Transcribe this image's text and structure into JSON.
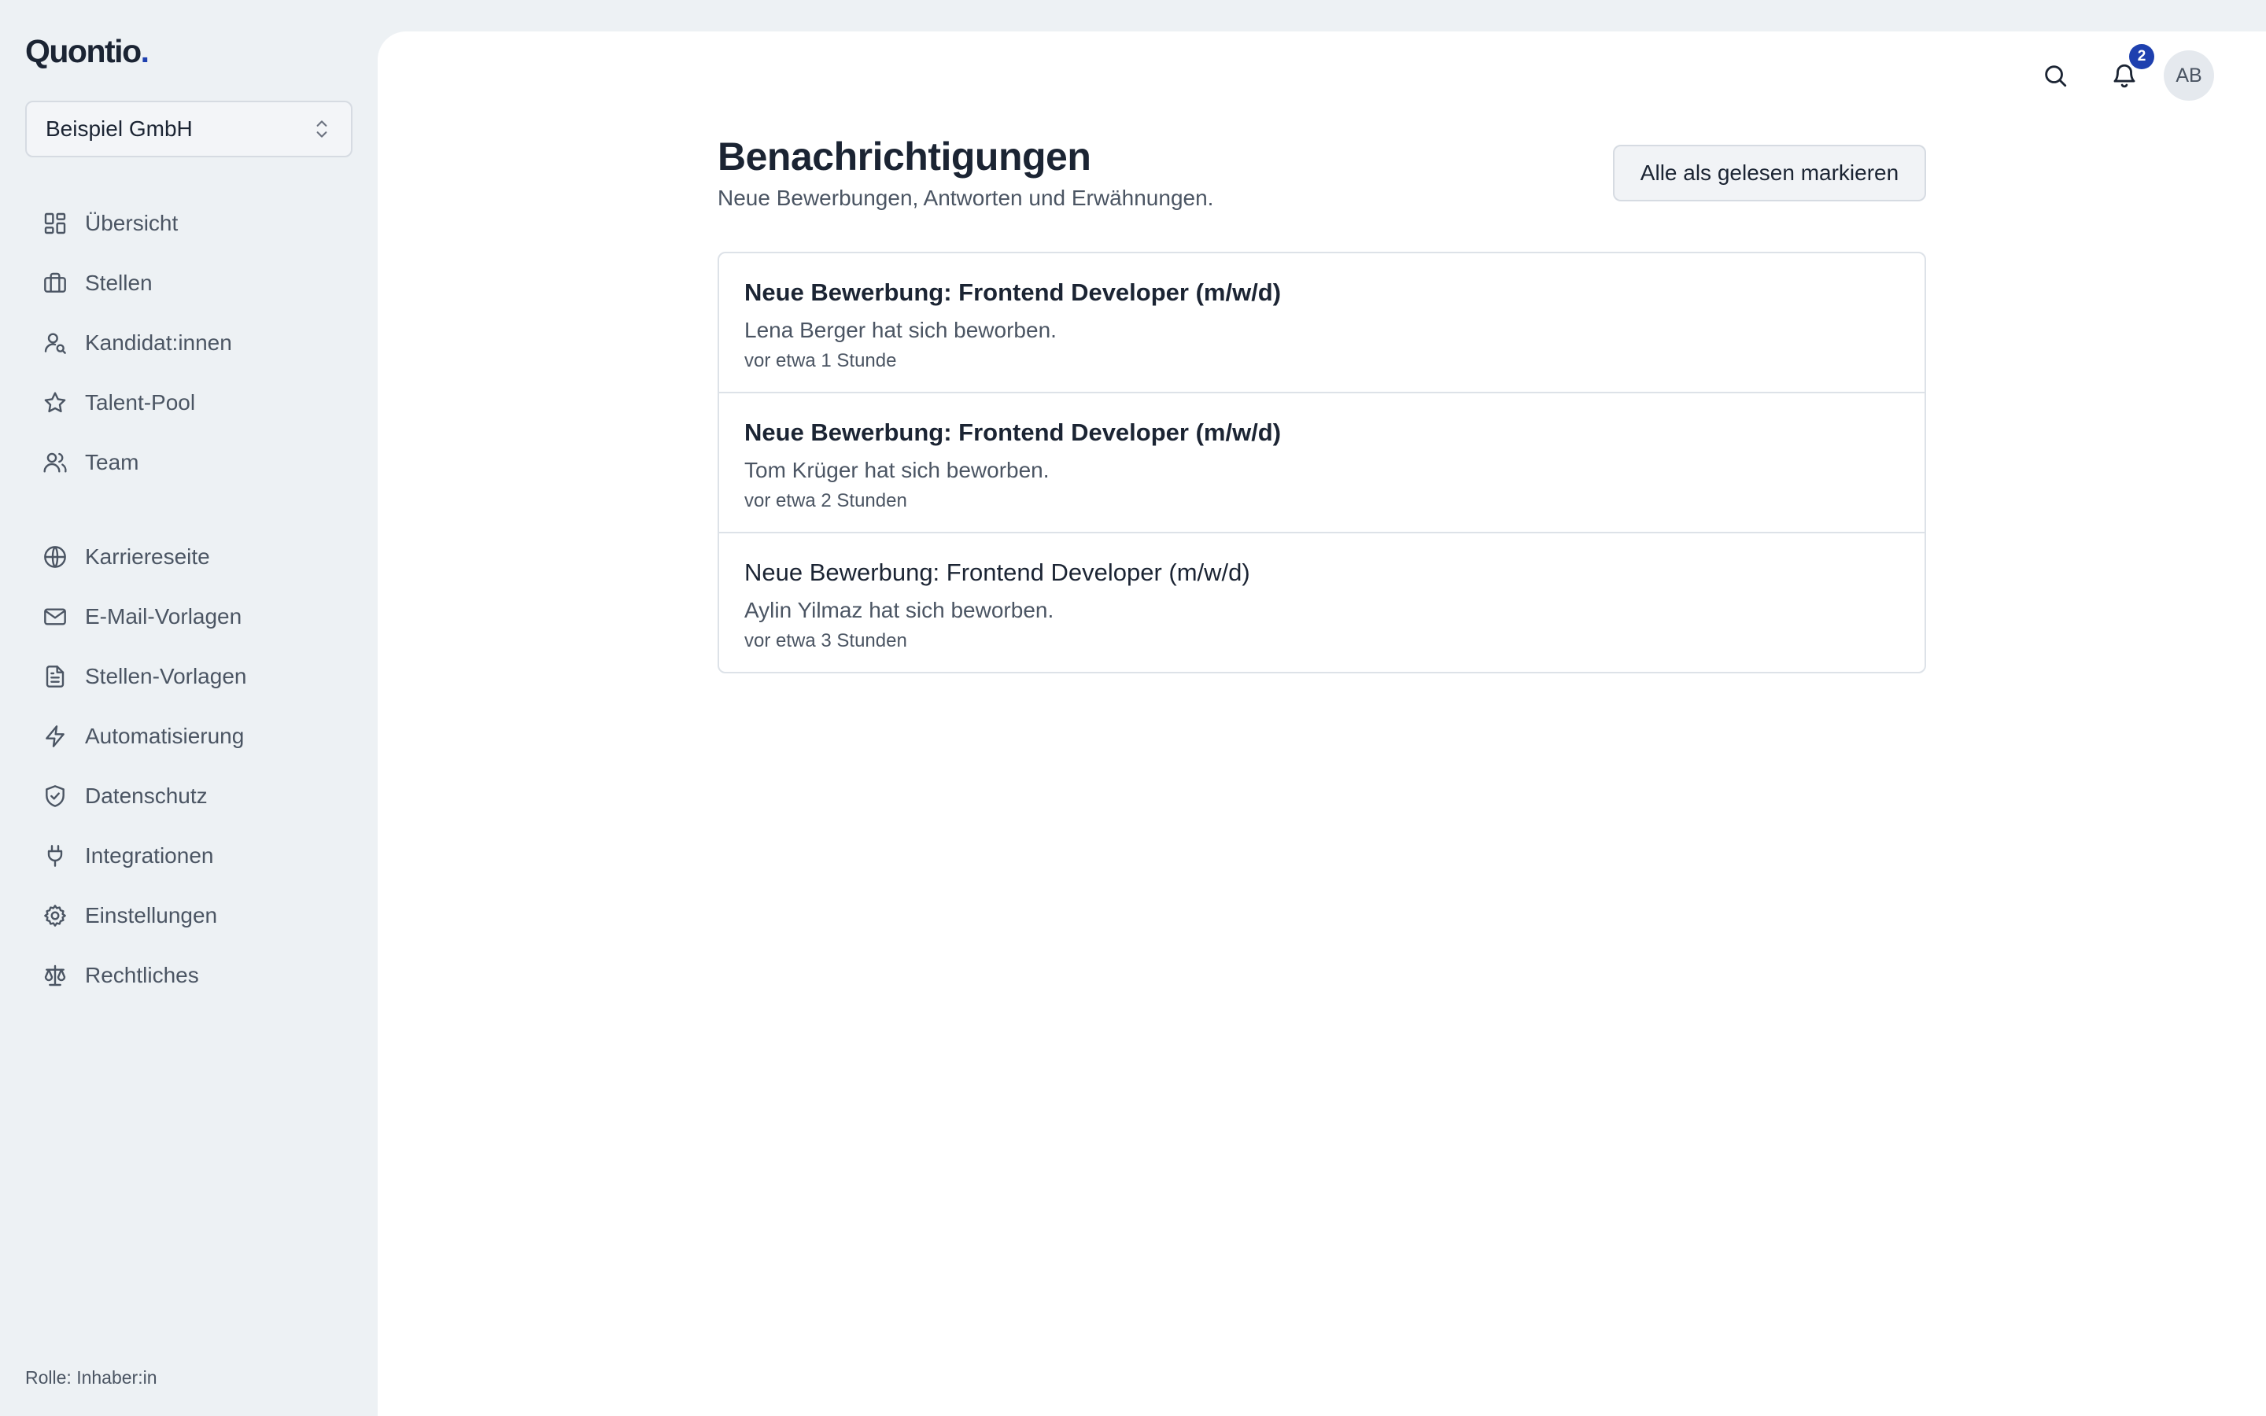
{
  "brand": {
    "name": "Quontio",
    "dot": ".",
    "accent": "#1e40af"
  },
  "org_select": {
    "label": "Beispiel GmbH"
  },
  "sidebar": {
    "items": [
      {
        "label": "Übersicht",
        "icon": "dashboard-icon"
      },
      {
        "label": "Stellen",
        "icon": "briefcase-icon"
      },
      {
        "label": "Kandidat:innen",
        "icon": "user-search-icon"
      },
      {
        "label": "Talent-Pool",
        "icon": "star-icon"
      },
      {
        "label": "Team",
        "icon": "users-icon"
      },
      {
        "label": "Karriereseite",
        "icon": "globe-icon"
      },
      {
        "label": "E-Mail-Vorlagen",
        "icon": "mail-icon"
      },
      {
        "label": "Stellen-Vorlagen",
        "icon": "file-text-icon"
      },
      {
        "label": "Automatisierung",
        "icon": "zap-icon"
      },
      {
        "label": "Datenschutz",
        "icon": "shield-check-icon"
      },
      {
        "label": "Integrationen",
        "icon": "plug-icon"
      },
      {
        "label": "Einstellungen",
        "icon": "gear-icon"
      },
      {
        "label": "Rechtliches",
        "icon": "scale-icon"
      }
    ],
    "role": "Rolle: Inhaber:in"
  },
  "topbar": {
    "notification_count": "2",
    "avatar_initials": "AB"
  },
  "page": {
    "title": "Benachrichtigungen",
    "subtitle": "Neue Bewerbungen, Antworten und Erwähnungen.",
    "mark_all_read": "Alle als gelesen markieren"
  },
  "notifications": [
    {
      "title": "Neue Bewerbung: Frontend Developer (m/w/d)",
      "body": "Lena Berger hat sich beworben.",
      "time": "vor etwa 1 Stunde",
      "unread": true
    },
    {
      "title": "Neue Bewerbung: Frontend Developer (m/w/d)",
      "body": "Tom Krüger hat sich beworben.",
      "time": "vor etwa 2 Stunden",
      "unread": true
    },
    {
      "title": "Neue Bewerbung: Frontend Developer (m/w/d)",
      "body": "Aylin Yilmaz hat sich beworben.",
      "time": "vor etwa 3 Stunden",
      "unread": false
    }
  ]
}
